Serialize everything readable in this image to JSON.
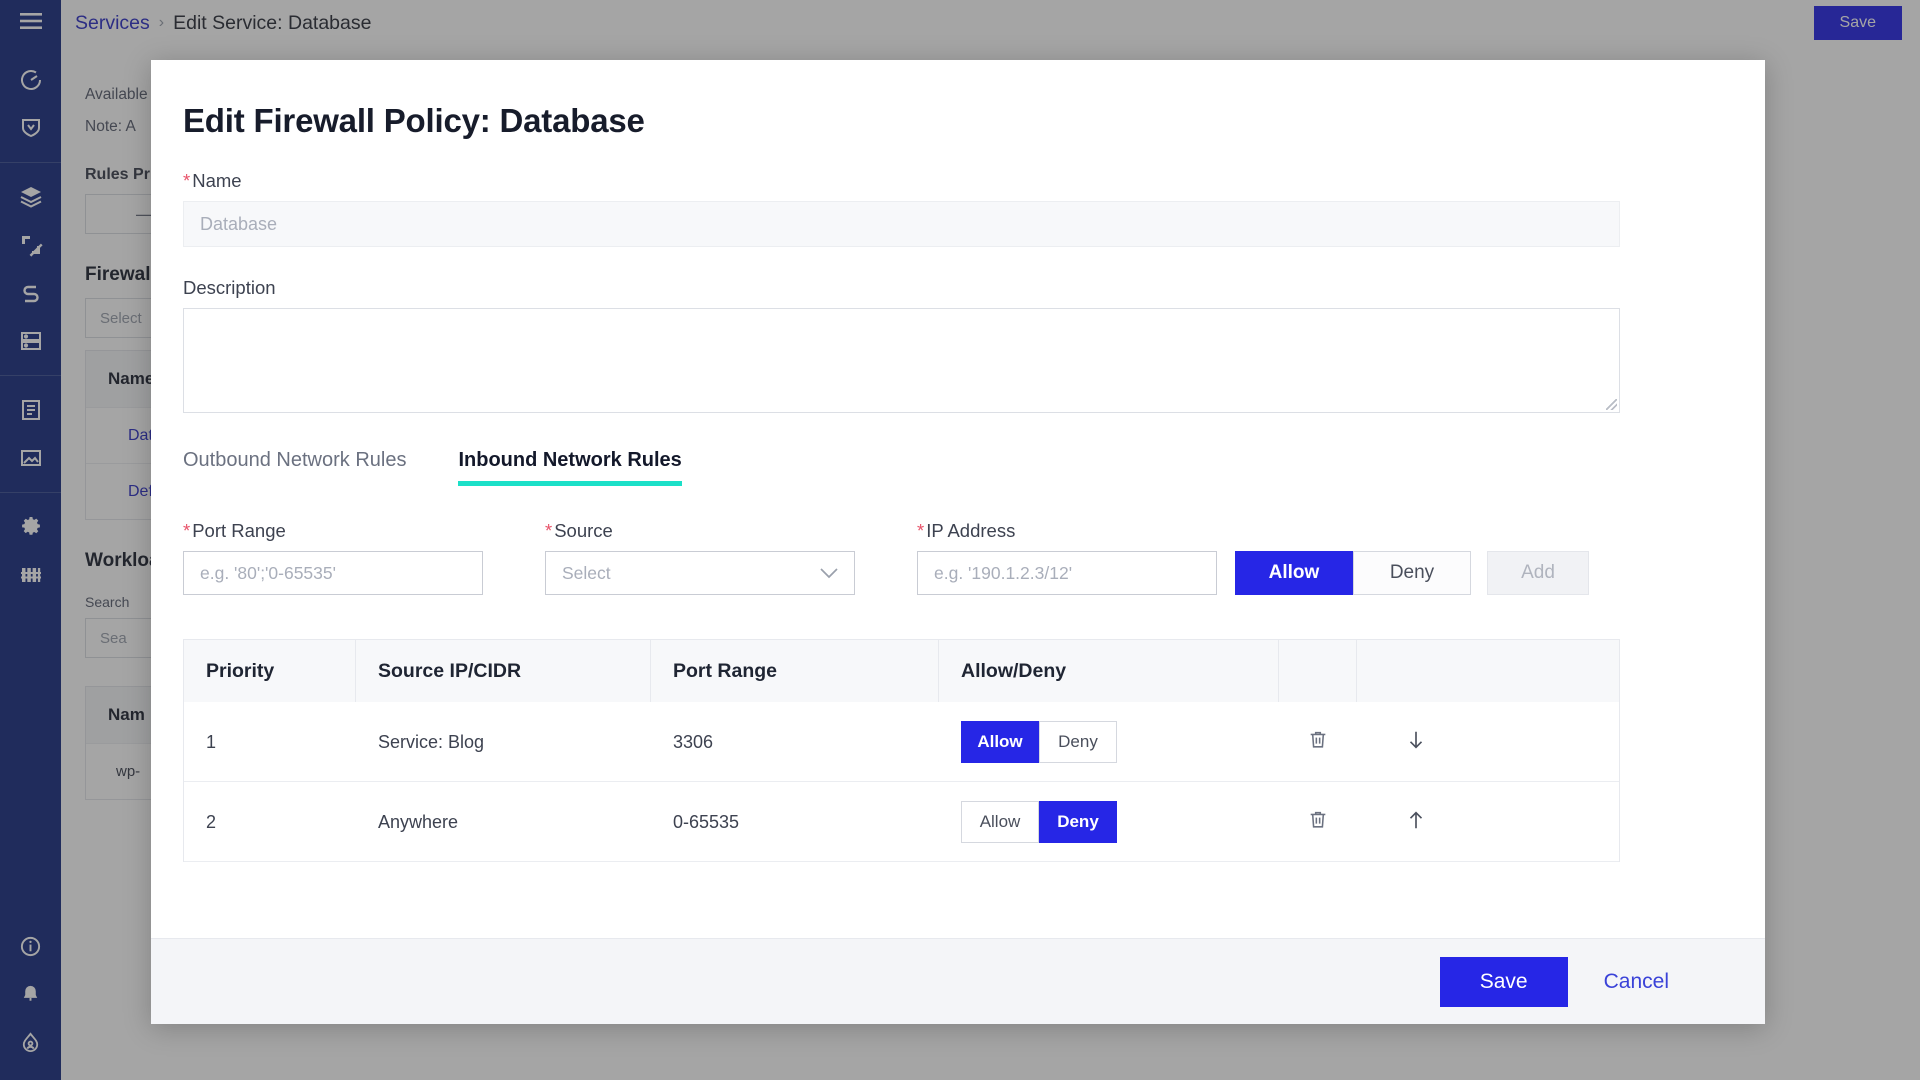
{
  "topbar": {
    "breadcrumb_root": "Services",
    "breadcrumb_sep": "›",
    "breadcrumb_current": "Edit Service: Database",
    "save_label": "Save"
  },
  "sidebar": {
    "menu_icon": "hamburger-icon",
    "items": [
      {
        "icon": "dashboard-icon"
      },
      {
        "icon": "shield-icon"
      },
      {
        "icon": "layers-icon"
      },
      {
        "icon": "analytics-icon"
      },
      {
        "icon": "network-icon"
      },
      {
        "icon": "server-icon"
      },
      {
        "icon": "document-icon"
      },
      {
        "icon": "image-icon"
      },
      {
        "icon": "gear-icon"
      },
      {
        "icon": "grid-icon"
      }
    ],
    "bottom_items": [
      {
        "icon": "info-icon"
      },
      {
        "icon": "bell-icon"
      },
      {
        "icon": "account-icon"
      }
    ]
  },
  "background_page": {
    "available_text": "Available",
    "note_text": "Note: A",
    "rules_priority_label": "Rules Prio",
    "stepper_value": "—",
    "firewall_heading": "Firewall",
    "firewall_select_placeholder": "Select",
    "table_header_name": "Name",
    "row1_name": "Data",
    "row2_name": "Defa",
    "workload_heading": "Workloa",
    "search_label": "Search",
    "search_placeholder": "Sea",
    "table2_header_name": "Nam",
    "table2_row1": "wp-"
  },
  "modal": {
    "title": "Edit Firewall Policy: Database",
    "required_marker": "*",
    "name": {
      "label": "Name",
      "value": "Database"
    },
    "description": {
      "label": "Description",
      "value": ""
    },
    "tabs": [
      {
        "label": "Outbound Network Rules",
        "active": false
      },
      {
        "label": "Inbound Network Rules",
        "active": true
      }
    ],
    "tab_accent_color": "#1ce0c8",
    "rule_form": {
      "port_range_label": "Port Range",
      "port_range_placeholder": "e.g. '80';'0-65535'",
      "source_label": "Source",
      "source_placeholder": "Select",
      "ip_address_label": "IP Address",
      "ip_address_placeholder": "e.g. '190.1.2.3/12'",
      "allow_label": "Allow",
      "deny_label": "Deny",
      "allow_selected": true,
      "add_label": "Add",
      "add_disabled": true
    },
    "rules_table": {
      "columns": [
        "Priority",
        "Source IP/CIDR",
        "Port Range",
        "Allow/Deny"
      ],
      "rows": [
        {
          "priority": "1",
          "source": "Service: Blog",
          "port_range": "3306",
          "allow_label": "Allow",
          "deny_label": "Deny",
          "decision": "allow",
          "delete_icon": "trash-icon",
          "move_icon": "arrow-down-icon"
        },
        {
          "priority": "2",
          "source": "Anywhere",
          "port_range": "0-65535",
          "allow_label": "Allow",
          "deny_label": "Deny",
          "decision": "deny",
          "delete_icon": "trash-icon",
          "move_icon": "arrow-up-icon"
        }
      ]
    },
    "footer": {
      "save_label": "Save",
      "cancel_label": "Cancel"
    }
  },
  "colors": {
    "primary_blue": "#2626e6",
    "rail_navy": "#1b3081",
    "accent_teal": "#1ce0c8",
    "required_red": "#e8546b",
    "link_blue": "#2f31c7"
  }
}
